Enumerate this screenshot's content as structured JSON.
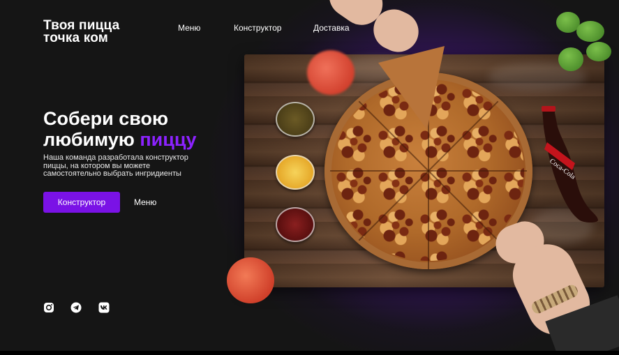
{
  "header": {
    "logo_line1": "Твоя пицца",
    "logo_line2": "точка ком",
    "nav": [
      {
        "label": "Меню"
      },
      {
        "label": "Конструктор"
      },
      {
        "label": "Доставка"
      }
    ]
  },
  "hero": {
    "title_line1": "Собери свою",
    "title_line2_prefix": "любимую",
    "title_line2_accent": "пиццу",
    "description_line1": "Наша команда разработала конструктор",
    "description_line2": "пиццы, на котором вы можете",
    "description_line3": "самостоятельно выбрать ингридиенты",
    "primary_button": "Конструктор",
    "secondary_link": "Меню"
  },
  "social": [
    {
      "icon": "instagram-icon"
    },
    {
      "icon": "telegram-icon"
    },
    {
      "icon": "vk-icon"
    }
  ],
  "colors": {
    "accent": "#7a12e6",
    "accent_text": "#8c22ff",
    "background": "#151515"
  },
  "bottle_label": "Coca-Cola"
}
